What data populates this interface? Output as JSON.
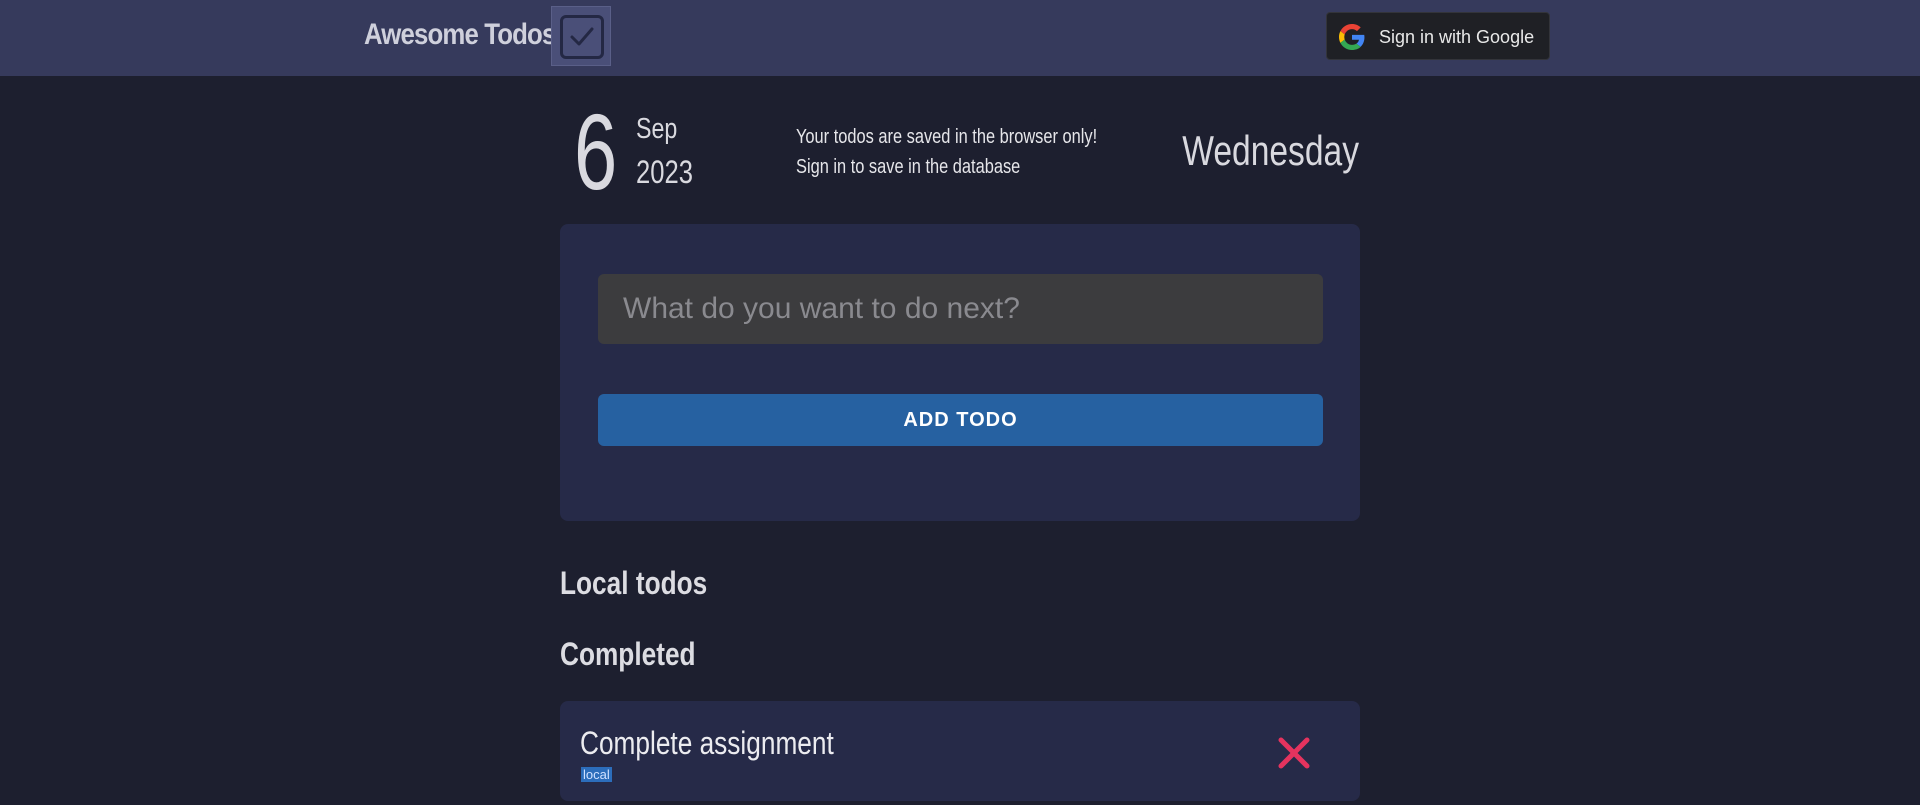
{
  "header": {
    "brand": "Awesome Todos",
    "google_button_label": "Sign in with Google"
  },
  "date": {
    "day": "6",
    "month": "Sep",
    "year": "2023",
    "weekday": "Wednesday"
  },
  "notice": {
    "line1": "Your todos are saved in the browser only!",
    "line2": "Sign in to save in the database"
  },
  "form": {
    "placeholder": "What do you want to do next?",
    "value": "",
    "add_label": "ADD TODO"
  },
  "sections": {
    "local": "Local todos",
    "completed": "Completed"
  },
  "completed_todos": [
    {
      "title": "Complete assignment",
      "tag": "local"
    }
  ],
  "colors": {
    "background": "#1d1f2f",
    "topbar": "#363a5c",
    "card": "#262a48",
    "accent": "#2661a1",
    "delete": "#e5335e"
  }
}
